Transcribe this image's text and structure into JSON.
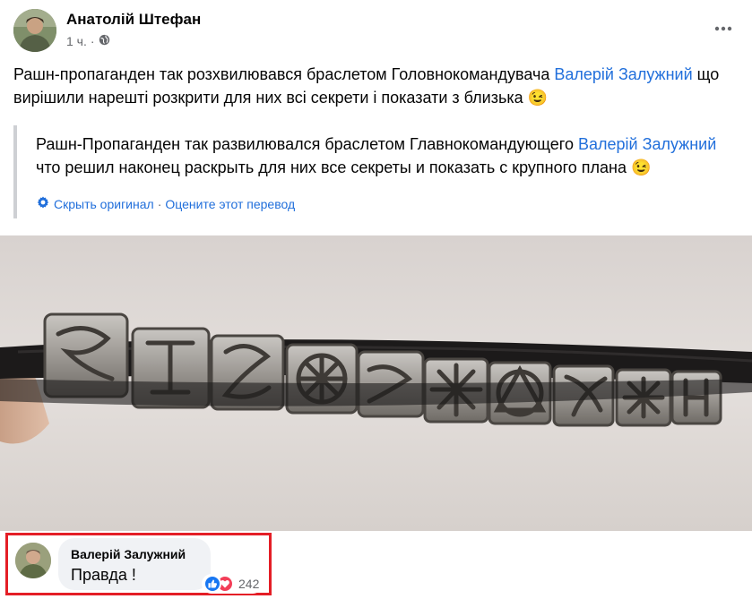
{
  "post": {
    "author": "Анатолій Штефан",
    "time": "1 ч.",
    "separator": "·",
    "text_before_link": "Рашн-пропаганден так розхвилювався браслетом Головнокомандувача ",
    "link_name": "Валерій Залужний",
    "text_after_link": " що вирішили нарешті розкрити для них всі секрети і показати з близька",
    "emoji": "😉"
  },
  "translation": {
    "text_before_link": "Рашн-Пропаганден так развилювался браслетом Главнокомандующего ",
    "link_name": "Валерій Залужний",
    "text_after_link": " что решил наконец раскрыть для них все секреты и показать с крупного плана",
    "emoji": "😉",
    "hide_original": "Скрыть оригинал",
    "rate_translation": "Оцените этот перевод",
    "separator": "·"
  },
  "comment": {
    "author": "Валерій Залужний",
    "text": "Правда !",
    "reaction_count": "242"
  },
  "icons": {
    "globe": "globe-icon",
    "more": "more-horizontal-icon",
    "settings": "gear-icon",
    "like": "like-reaction-icon",
    "love": "love-reaction-icon"
  },
  "colors": {
    "link": "#216fdb",
    "highlight_border": "#e41e26",
    "like": "#1877f2",
    "love": "#f33e58"
  }
}
